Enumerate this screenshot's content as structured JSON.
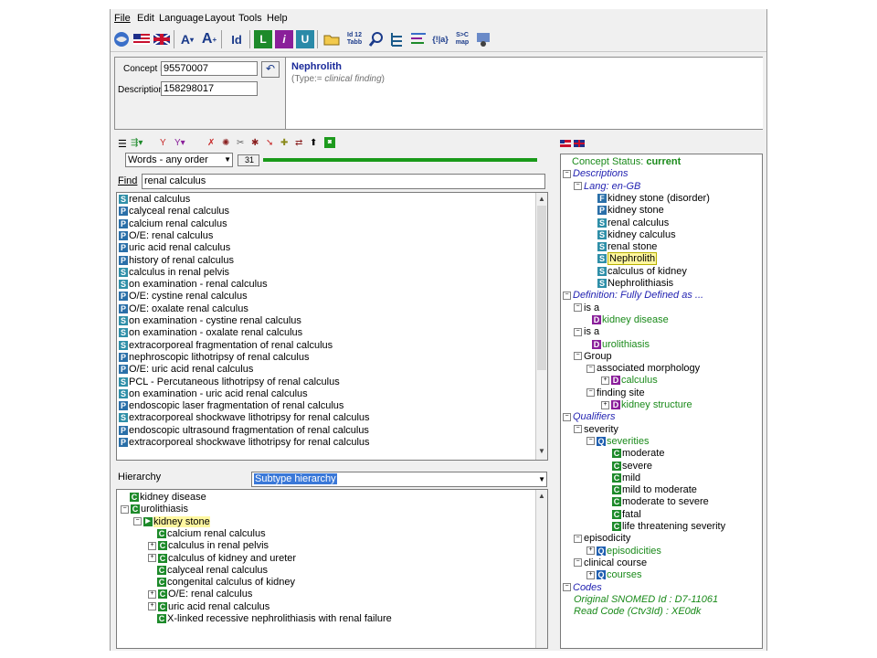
{
  "menu": [
    "File",
    "Edit",
    "Language",
    "Layout",
    "Tools",
    "Help"
  ],
  "toolbar": {
    "id_label": "Id",
    "font_inc": "A",
    "font_inc2": "A",
    "id12_label": "Id 12 Tabb",
    "map_label": "S>C map"
  },
  "header": {
    "concept_id_label": "Concept Id",
    "concept_id": "95570007",
    "description_id_label": "DescriptionId",
    "description_id": "158298017",
    "term": "Nephrolith",
    "type_prefix": "(Type:= ",
    "type_value": "clinical finding",
    "type_suffix": ")"
  },
  "search": {
    "mode": "Words - any order",
    "count": "31",
    "find_label": "Find",
    "find_value": "renal calculus"
  },
  "results": [
    {
      "b": "S",
      "t": "renal calculus"
    },
    {
      "b": "P",
      "t": "calyceal renal calculus"
    },
    {
      "b": "P",
      "t": "calcium renal calculus"
    },
    {
      "b": "P",
      "t": "O/E: renal calculus"
    },
    {
      "b": "P",
      "t": "uric acid renal calculus"
    },
    {
      "b": "P",
      "t": "history of renal calculus"
    },
    {
      "b": "S",
      "t": "calculus in renal pelvis"
    },
    {
      "b": "S",
      "t": "on examination - renal calculus"
    },
    {
      "b": "P",
      "t": "O/E: cystine renal calculus"
    },
    {
      "b": "P",
      "t": "O/E: oxalate renal calculus"
    },
    {
      "b": "S",
      "t": "on examination - cystine renal calculus"
    },
    {
      "b": "S",
      "t": "on examination - oxalate renal calculus"
    },
    {
      "b": "S",
      "t": "extracorporeal fragmentation of renal calculus"
    },
    {
      "b": "P",
      "t": "nephroscopic lithotripsy of renal calculus"
    },
    {
      "b": "P",
      "t": "O/E: uric acid renal calculus"
    },
    {
      "b": "S",
      "t": "PCL - Percutaneous lithotripsy of renal calculus"
    },
    {
      "b": "S",
      "t": "on examination - uric acid renal calculus"
    },
    {
      "b": "P",
      "t": "endoscopic laser fragmentation of renal calculus"
    },
    {
      "b": "S",
      "t": "extracorporeal shockwave lithotripsy for renal calculus"
    },
    {
      "b": "P",
      "t": "endoscopic ultrasound fragmentation of renal calculus"
    },
    {
      "b": "P",
      "t": "extracorporeal shockwave lithotripsy for renal calculus"
    }
  ],
  "hierarchy": {
    "label": "Hierarchy",
    "mode": "Subtype hierarchy",
    "items": [
      {
        "t": "kidney disease"
      },
      {
        "t": "urolithiasis"
      },
      {
        "t": "kidney stone"
      },
      {
        "t": "calcium renal calculus"
      },
      {
        "t": "calculus in renal pelvis"
      },
      {
        "t": "calculus of kidney and ureter"
      },
      {
        "t": "calyceal renal calculus"
      },
      {
        "t": "congenital calculus of kidney"
      },
      {
        "t": "O/E: renal calculus"
      },
      {
        "t": "uric acid renal calculus"
      },
      {
        "t": "X-linked recessive nephrolithiasis with renal failure"
      }
    ]
  },
  "detail": {
    "status_label": "Concept Status: ",
    "status_value": "current",
    "descriptions": "Descriptions",
    "lang": "Lang: en-GB",
    "terms": [
      {
        "b": "F",
        "t": "kidney stone (disorder)"
      },
      {
        "b": "P",
        "t": "kidney stone"
      },
      {
        "b": "S",
        "t": "renal calculus"
      },
      {
        "b": "S",
        "t": "kidney calculus"
      },
      {
        "b": "S",
        "t": "renal stone"
      },
      {
        "b": "S",
        "t": "Nephrolith"
      },
      {
        "b": "S",
        "t": "calculus of kidney"
      },
      {
        "b": "S",
        "t": "Nephrolithiasis"
      }
    ],
    "definition": "Definition: Fully Defined as ...",
    "is_a_1": "is a",
    "is_a_1_target": "kidney disease",
    "is_a_2": "is a",
    "is_a_2_target": "urolithiasis",
    "group": "Group",
    "assoc_morph": "associated morphology",
    "assoc_morph_target": "calculus",
    "finding_site": "finding site",
    "finding_site_target": "kidney structure",
    "qualifiers": "Qualifiers",
    "severity": "severity",
    "severities": "severities",
    "severity_values": [
      "moderate",
      "severe",
      "mild",
      "mild to moderate",
      "moderate to severe",
      "fatal",
      "life threatening severity"
    ],
    "episodicity": "episodicity",
    "episodicities": "episodicities",
    "clinical_course": "clinical course",
    "courses": "courses",
    "codes": "Codes",
    "original_snomed": "Original SNOMED Id : D7-11061",
    "read_code": "Read Code (Ctv3Id) : XE0dk"
  }
}
